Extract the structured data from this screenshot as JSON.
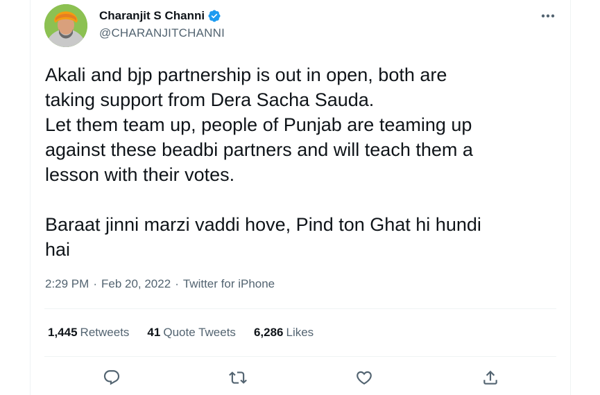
{
  "author": {
    "name": "Charanjit S Channi",
    "handle": "@CHARANJITCHANNI",
    "verified": true
  },
  "tweet": {
    "paragraph1": [
      "Akali and bjp partnership is out in open, both are",
      "taking support from Dera Sacha Sauda.",
      "Let them team up, people of Punjab are teaming up",
      "against these beadbi partners and will teach them a",
      "lesson with their votes."
    ],
    "paragraph2": [
      "Baraat jinni marzi vaddi hove, Pind ton Ghat hi hundi",
      "hai"
    ]
  },
  "meta": {
    "time": "2:29 PM",
    "sep1": "·",
    "date": "Feb 20, 2022",
    "sep2": "·",
    "source": "Twitter for iPhone"
  },
  "stats": {
    "retweets_count": "1,445",
    "retweets_label": "Retweets",
    "quotes_count": "41",
    "quotes_label": "Quote Tweets",
    "likes_count": "6,286",
    "likes_label": "Likes"
  },
  "icons": {
    "more": "more-icon",
    "reply": "reply-icon",
    "retweet": "retweet-icon",
    "like": "like-icon",
    "share": "share-icon",
    "verified": "verified-badge-icon"
  },
  "colors": {
    "text_primary": "#0f1419",
    "text_secondary": "#536471",
    "verified_blue": "#1d9bf0",
    "divider": "#eff3f4"
  }
}
